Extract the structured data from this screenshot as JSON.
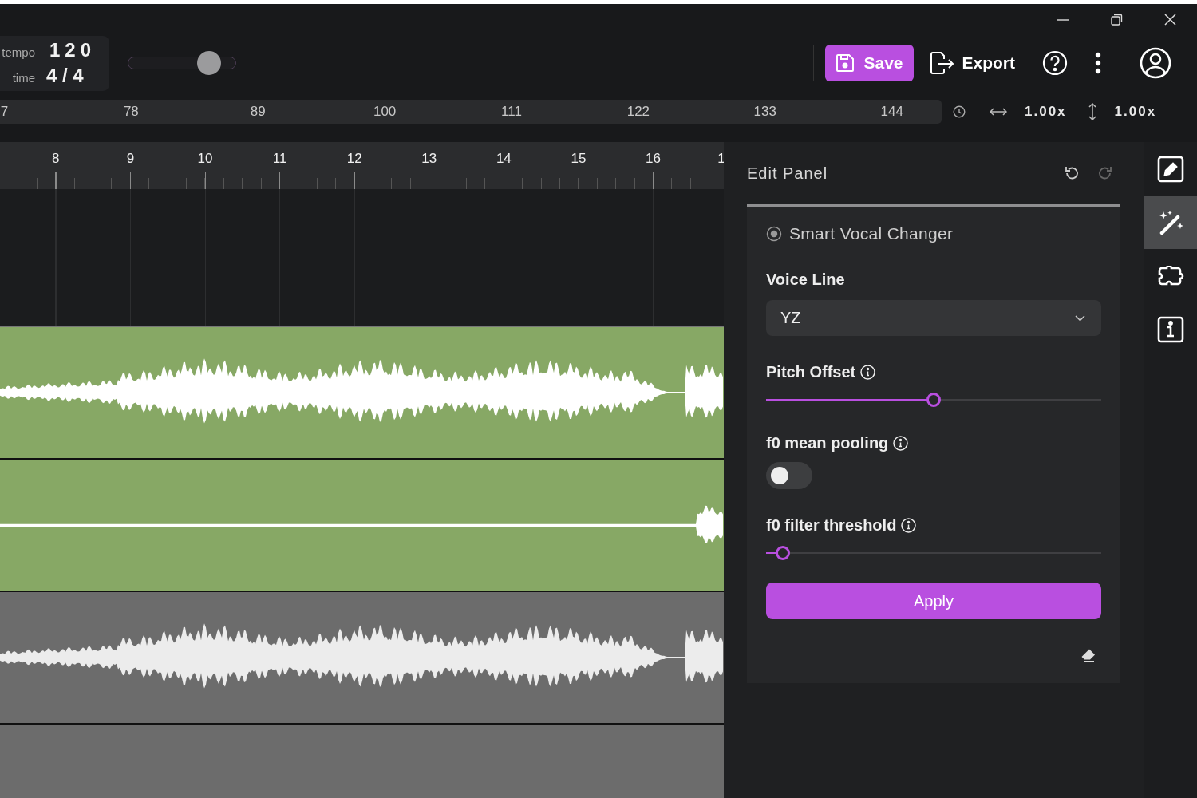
{
  "header": {
    "tempo": {
      "label": "tempo",
      "value": "120"
    },
    "time": {
      "label": "time",
      "value": "4 / 4"
    },
    "zoom_slider": {
      "level": 0.75
    },
    "save": "Save",
    "export": "Export"
  },
  "overview_ruler": {
    "marks": [
      "7",
      "78",
      "89",
      "100",
      "111",
      "122",
      "133",
      "144"
    ],
    "horizontal_zoom": "1.00x",
    "vertical_zoom": "1.00x"
  },
  "timeline": {
    "bars": [
      "8",
      "9",
      "10",
      "11",
      "12",
      "13",
      "14",
      "15",
      "16",
      "1"
    ]
  },
  "tracks": [
    {
      "kind": "vocal",
      "selected": true
    },
    {
      "kind": "quiet",
      "selected": true
    },
    {
      "kind": "vocal",
      "selected": false
    }
  ],
  "edit_panel": {
    "title": "Edit Panel",
    "redo": {
      "disabled": true
    },
    "tool": "Smart Vocal Changer",
    "voice_line": {
      "label": "Voice Line",
      "value": "YZ"
    },
    "pitch_offset": {
      "label": "Pitch Offset",
      "level": 0.5
    },
    "mean_pooling": {
      "label": "f0 mean pooling",
      "on": false
    },
    "filter_threshold": {
      "label": "f0 filter threshold",
      "level": 0.05
    },
    "apply": "Apply"
  },
  "side_tools": [
    {
      "kind": "edit",
      "selected": false
    },
    {
      "kind": "wand",
      "selected": true
    },
    {
      "kind": "puzzle",
      "selected": false
    },
    {
      "kind": "info",
      "selected": false
    }
  ]
}
